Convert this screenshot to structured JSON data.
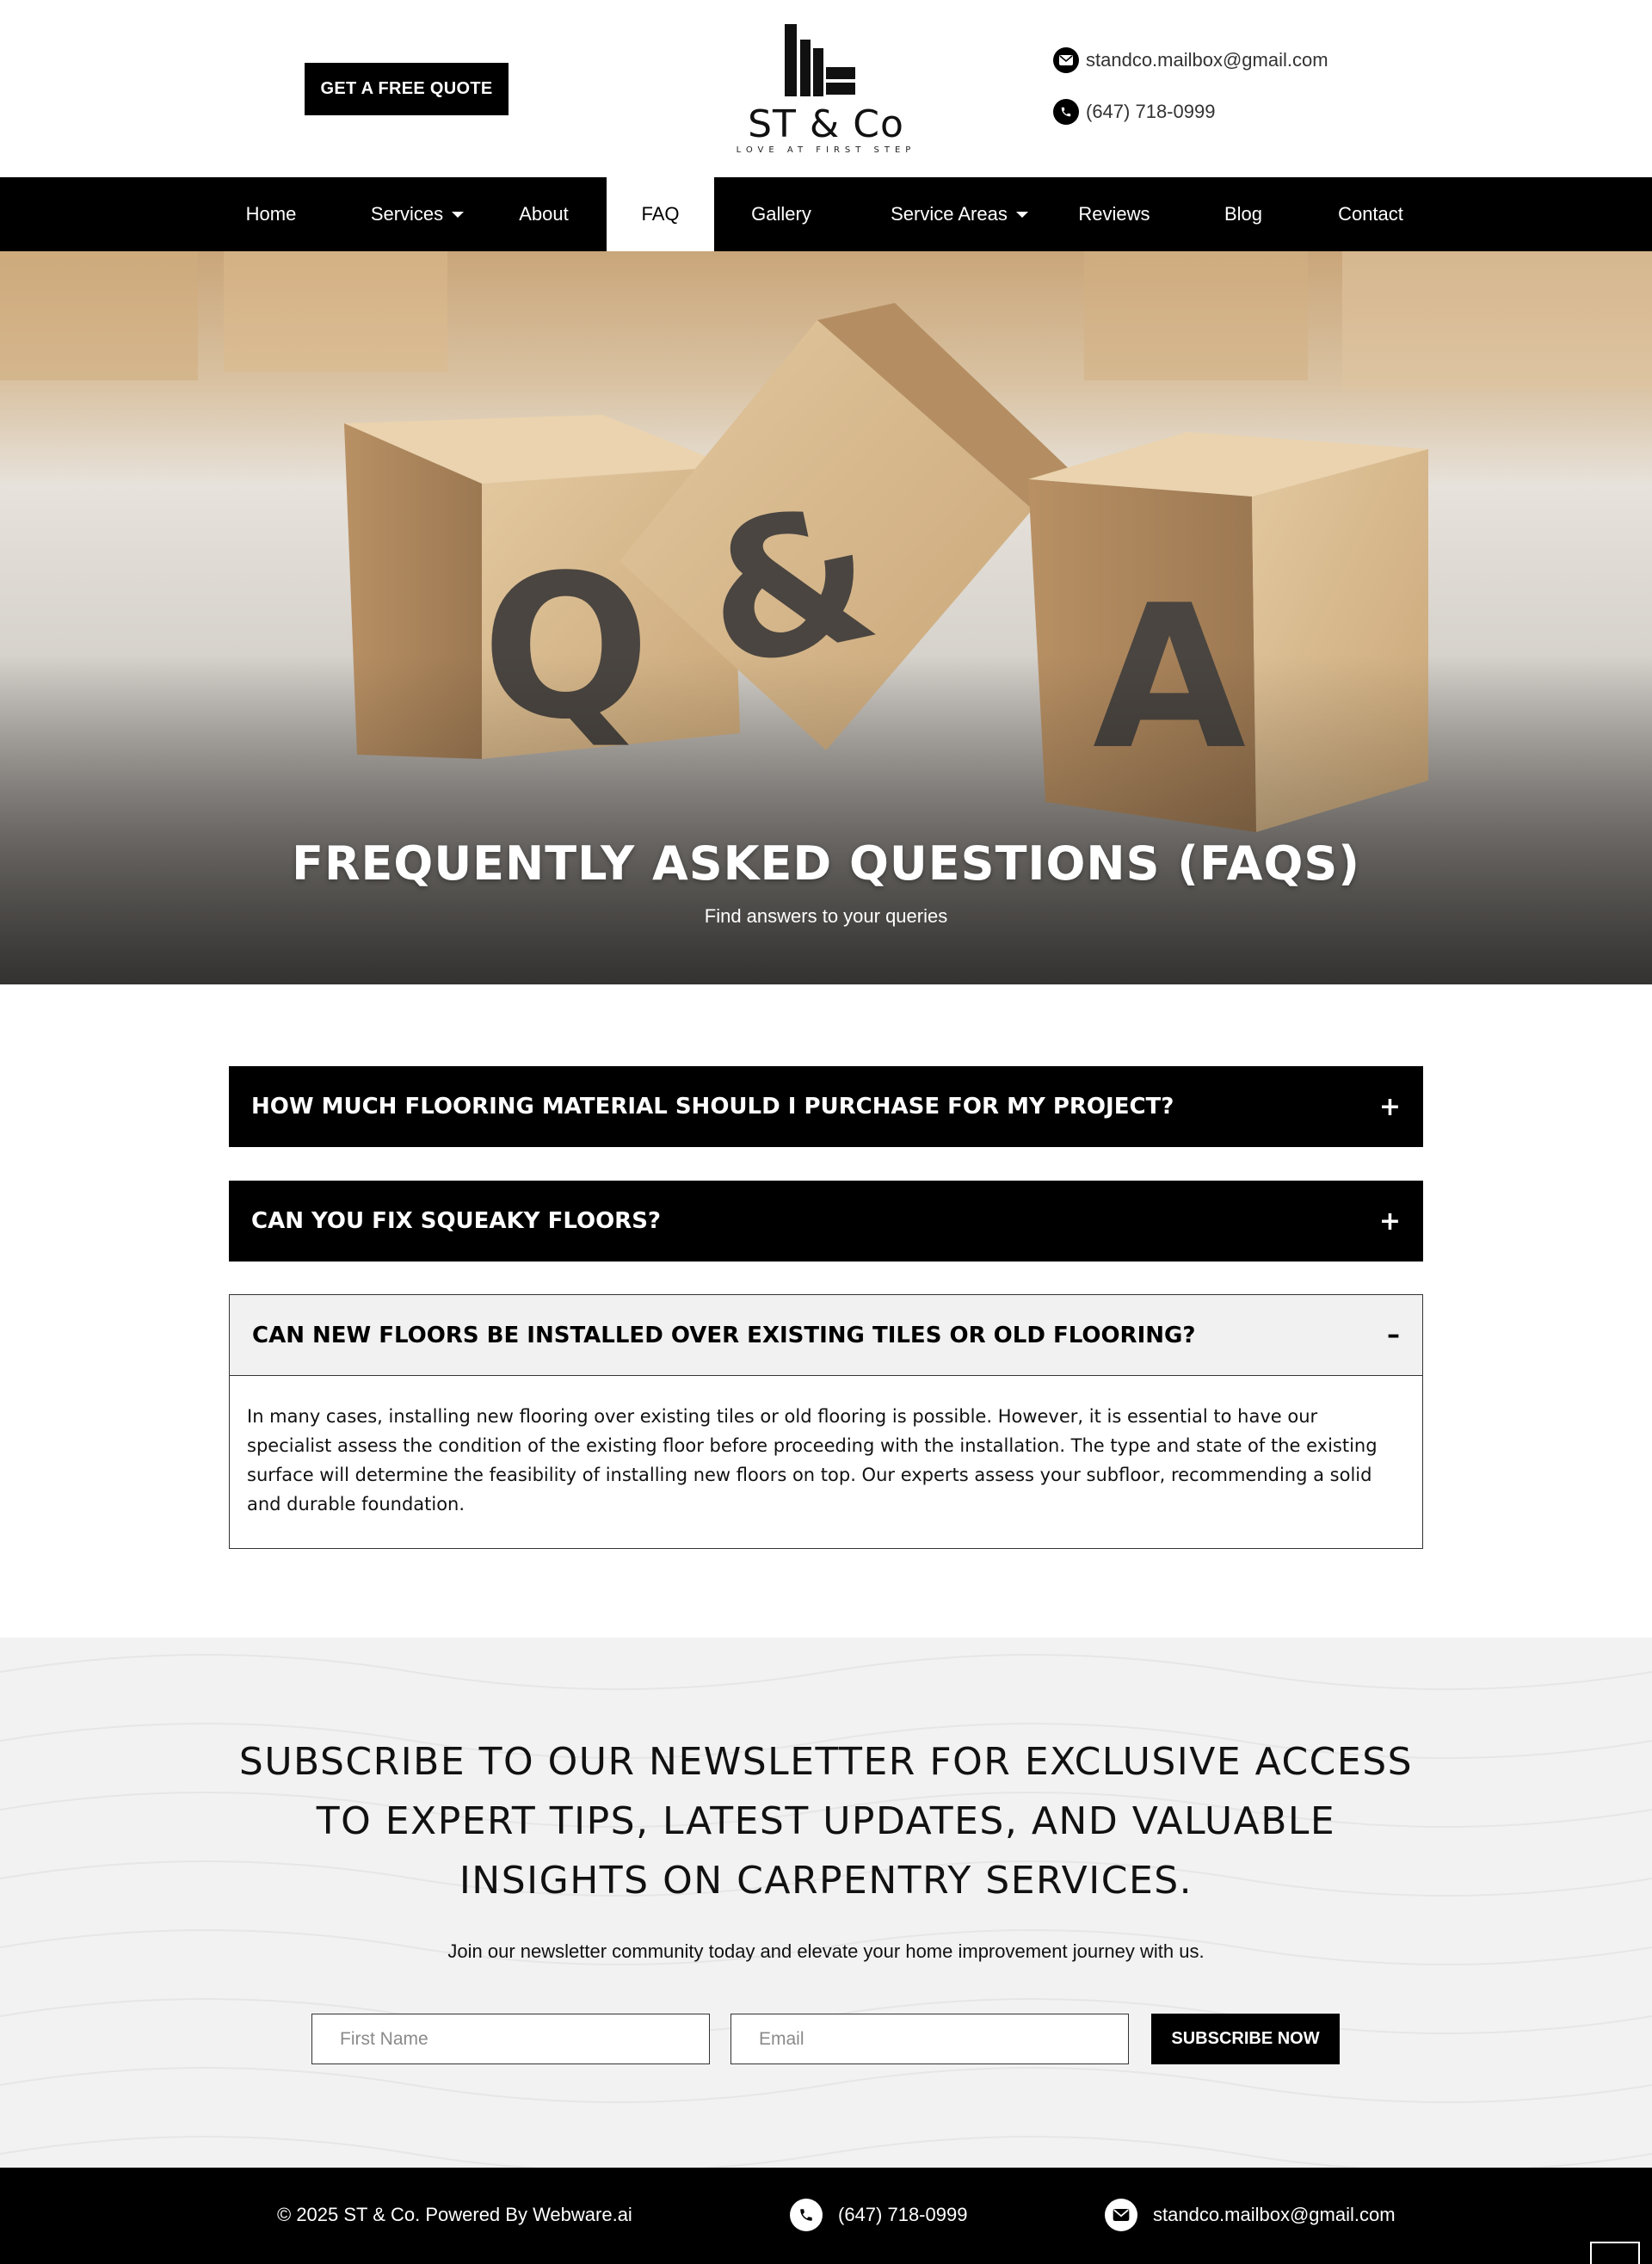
{
  "header": {
    "quote_button": "GET A FREE QUOTE",
    "logo_text": "ST & Co",
    "logo_tagline": "LOVE AT FIRST STEP",
    "email": "standco.mailbox@gmail.com",
    "phone": "(647) 718-0999"
  },
  "nav": {
    "items": [
      {
        "label": "Home",
        "has_dropdown": false,
        "active": false
      },
      {
        "label": "Services",
        "has_dropdown": true,
        "active": false
      },
      {
        "label": "About",
        "has_dropdown": false,
        "active": false
      },
      {
        "label": "FAQ",
        "has_dropdown": false,
        "active": true
      },
      {
        "label": "Gallery",
        "has_dropdown": false,
        "active": false
      },
      {
        "label": "Service Areas",
        "has_dropdown": true,
        "active": false
      },
      {
        "label": "Reviews",
        "has_dropdown": false,
        "active": false
      },
      {
        "label": "Blog",
        "has_dropdown": false,
        "active": false
      },
      {
        "label": "Contact",
        "has_dropdown": false,
        "active": false
      }
    ]
  },
  "hero": {
    "title": "FREQUENTLY ASKED QUESTIONS (FAQS)",
    "subtitle": "Find answers to your queries",
    "blocks": [
      "Q",
      "&",
      "A"
    ]
  },
  "faq": {
    "items": [
      {
        "question": "HOW MUCH FLOORING MATERIAL SHOULD I PURCHASE FOR MY PROJECT?",
        "sign": "+",
        "open": false
      },
      {
        "question": "CAN YOU FIX SQUEAKY FLOORS?",
        "sign": "+",
        "open": false
      },
      {
        "question": "CAN NEW FLOORS BE INSTALLED OVER EXISTING TILES OR OLD FLOORING?",
        "sign": "–",
        "open": true,
        "answer": "In many cases, installing new flooring over existing tiles or old flooring is possible. However, it is essential to have our specialist assess the condition of the existing floor before proceeding with the installation. The type and state of the existing surface will determine the feasibility of installing new floors on top. Our experts assess your subfloor, recommending a solid and durable foundation."
      }
    ]
  },
  "newsletter": {
    "title": "SUBSCRIBE TO OUR NEWSLETTER FOR EXCLUSIVE ACCESS TO EXPERT TIPS, LATEST UPDATES, AND VALUABLE INSIGHTS ON CARPENTRY SERVICES.",
    "subtitle": "Join our newsletter community today and elevate your home improvement journey with us.",
    "first_name_placeholder": "First Name",
    "email_placeholder": "Email",
    "button": "SUBSCRIBE NOW"
  },
  "footer": {
    "copyright": "© 2025 ST & Co. Powered By Webware.ai",
    "phone": "(647) 718-0999",
    "email": "standco.mailbox@gmail.com"
  },
  "colors": {
    "primary": "#000000",
    "background": "#ffffff",
    "newsletter_bg": "#f2f2f2",
    "open_faq_bg": "#f1f1f1"
  }
}
